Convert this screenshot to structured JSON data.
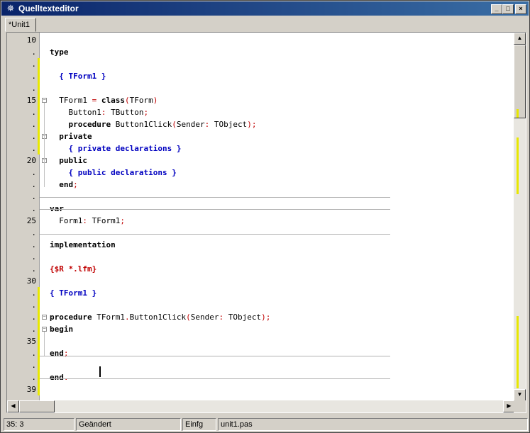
{
  "window": {
    "title": "Quelltexteditor",
    "icon": "lazarus-icon",
    "buttons": [
      "minimize-icon",
      "maximize-icon",
      "close-icon"
    ]
  },
  "tabs": [
    {
      "label": "*Unit1",
      "active": true
    }
  ],
  "gutter": [
    "10",
    ".",
    ".",
    ".",
    ".",
    "15",
    ".",
    ".",
    ".",
    ".",
    "20",
    ".",
    ".",
    ".",
    ".",
    "25",
    ".",
    ".",
    ".",
    ".",
    "30",
    ".",
    ".",
    ".",
    ".",
    "35",
    ".",
    ".",
    ".",
    "39"
  ],
  "code_lines": [
    "",
    "type",
    "",
    "  { TForm1 }",
    "",
    "  TForm1 = class(TForm)",
    "    Button1: TButton;",
    "    procedure Button1Click(Sender: TObject);",
    "  private",
    "    { private declarations }",
    "  public",
    "    { public declarations }",
    "  end;",
    "",
    "var",
    "  Form1: TForm1;",
    "",
    "implementation",
    "",
    "{$R *.lfm}",
    "",
    "{ TForm1 }",
    "",
    "procedure TForm1.Button1Click(Sender: TObject);",
    "begin",
    "",
    "end;",
    "",
    "end.",
    ""
  ],
  "status": {
    "position": "35:  3",
    "state": "Geändert",
    "mode": "Einfg",
    "file": "unit1.pas"
  },
  "colors": {
    "titlebar_start": "#0a246a",
    "titlebar_end": "#3a6ea5",
    "modified_marker": "#e8e800",
    "keyword": "#000000",
    "symbol": "#c00000",
    "comment": "#0000c0"
  }
}
